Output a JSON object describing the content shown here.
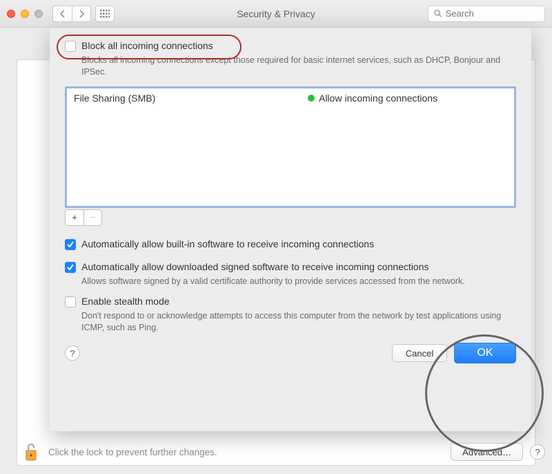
{
  "titlebar": {
    "title": "Security & Privacy",
    "search_placeholder": "Search"
  },
  "sheet": {
    "block_all": {
      "checked": false,
      "label": "Block all incoming connections",
      "desc": "Blocks all incoming connections except those required for basic internet services, such as DHCP, Bonjour and IPSec."
    },
    "list": {
      "rows": [
        {
          "app": "File Sharing (SMB)",
          "status_color": "#2cbf3f",
          "status": "Allow incoming connections"
        }
      ]
    },
    "auto_builtin": {
      "checked": true,
      "label": "Automatically allow built-in software to receive incoming connections"
    },
    "auto_signed": {
      "checked": true,
      "label": "Automatically allow downloaded signed software to receive incoming connections",
      "desc": "Allows software signed by a valid certificate authority to provide services accessed from the network."
    },
    "stealth": {
      "checked": false,
      "label": "Enable stealth mode",
      "desc": "Don't respond to or acknowledge attempts to access this computer from the network by test applications using ICMP, such as Ping."
    },
    "buttons": {
      "cancel": "Cancel",
      "ok": "OK",
      "help": "?"
    }
  },
  "bottom": {
    "lock_text": "Click the lock to prevent further changes.",
    "advanced": "Advanced…",
    "help": "?"
  }
}
